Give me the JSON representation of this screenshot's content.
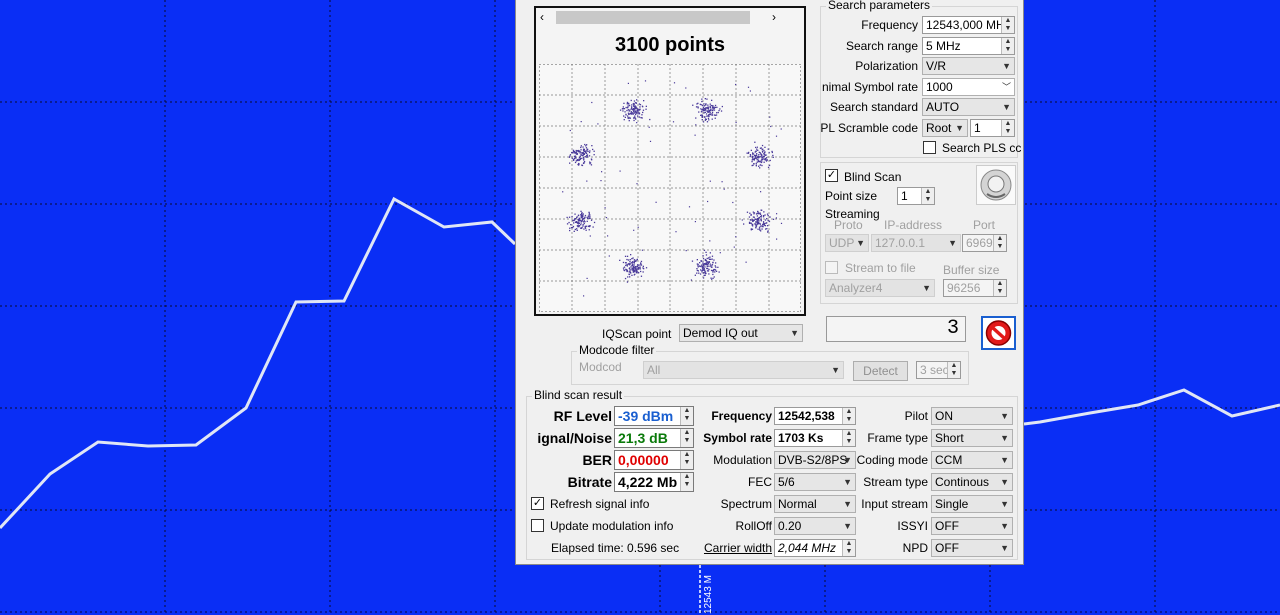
{
  "background": {
    "color": "#0a2ef5",
    "marker_label": "12543 M"
  },
  "constellation": {
    "title": "3100 points",
    "dot_color": "#4a3a9a"
  },
  "search": {
    "group_title": "Search parameters",
    "frequency_label": "Frequency",
    "frequency_value": "12543,000 MH",
    "range_label": "Search range",
    "range_value": "5 MHz",
    "polarization_label": "Polarization",
    "polarization_value": "V/R",
    "min_sr_label": "nimal Symbol rate",
    "min_sr_value": "1000",
    "standard_label": "Search standard",
    "standard_value": "AUTO",
    "pl_label": "PL Scramble code",
    "pl_mode": "Root",
    "pl_value": "1",
    "pls_label": "Search PLS cc"
  },
  "blind": {
    "label": "Blind Scan",
    "point_size_label": "Point size",
    "point_size_value": "1"
  },
  "streaming": {
    "title": "Streaming",
    "proto_label": "Proto",
    "ip_label": "IP-address",
    "port_label": "Port",
    "proto_value": "UDP",
    "ip_value": "127.0.0.1",
    "port_value": "6969",
    "stream_to_file": "Stream to file",
    "buffer_label": "Buffer size",
    "file_value": "Analyzer4",
    "buffer_value": "96256"
  },
  "iq": {
    "label": "IQScan point",
    "value": "Demod IQ out",
    "counter": "3"
  },
  "modcode": {
    "title": "Modcode filter",
    "label": "Modcode",
    "value": "All",
    "detect": "Detect",
    "seconds": "3 sec"
  },
  "result": {
    "title": "Blind scan result",
    "rf_label": "RF Level",
    "rf_value": "-39 dBm",
    "snr_label": "ignal/Noise",
    "snr_value": "21,3 dB",
    "ber_label": "BER",
    "ber_value": "0,00000",
    "bitrate_label": "Bitrate",
    "bitrate_value": "4,222 Mb",
    "freq_label": "Frequency",
    "freq_value": "12542,538",
    "sr_label": "Symbol rate",
    "sr_value": "1703 Ks",
    "mod_label": "Modulation",
    "mod_value": "DVB-S2/8PS",
    "fec_label": "FEC",
    "fec_value": "5/6",
    "spectrum_label": "Spectrum",
    "spectrum_value": "Normal",
    "rolloff_label": "RollOff",
    "rolloff_value": "0.20",
    "carrier_label": "Carrier width",
    "carrier_value": "2,044 MHz",
    "pilot_label": "Pilot",
    "pilot_value": "ON",
    "frame_label": "Frame type",
    "frame_value": "Short",
    "coding_label": "Coding mode",
    "coding_value": "CCM",
    "stream_label": "Stream type",
    "stream_value": "Continous",
    "input_label": "Input stream",
    "input_value": "Single",
    "issyi_label": "ISSYI",
    "issyi_value": "OFF",
    "npd_label": "NPD",
    "npd_value": "OFF",
    "refresh_label": "Refresh signal info",
    "update_label": "Update modulation info",
    "elapsed": "Elapsed time: 0.596 sec"
  },
  "colors": {
    "rf": "#1a5fd0",
    "snr": "#0a7a0a",
    "ber": "#e00000"
  }
}
